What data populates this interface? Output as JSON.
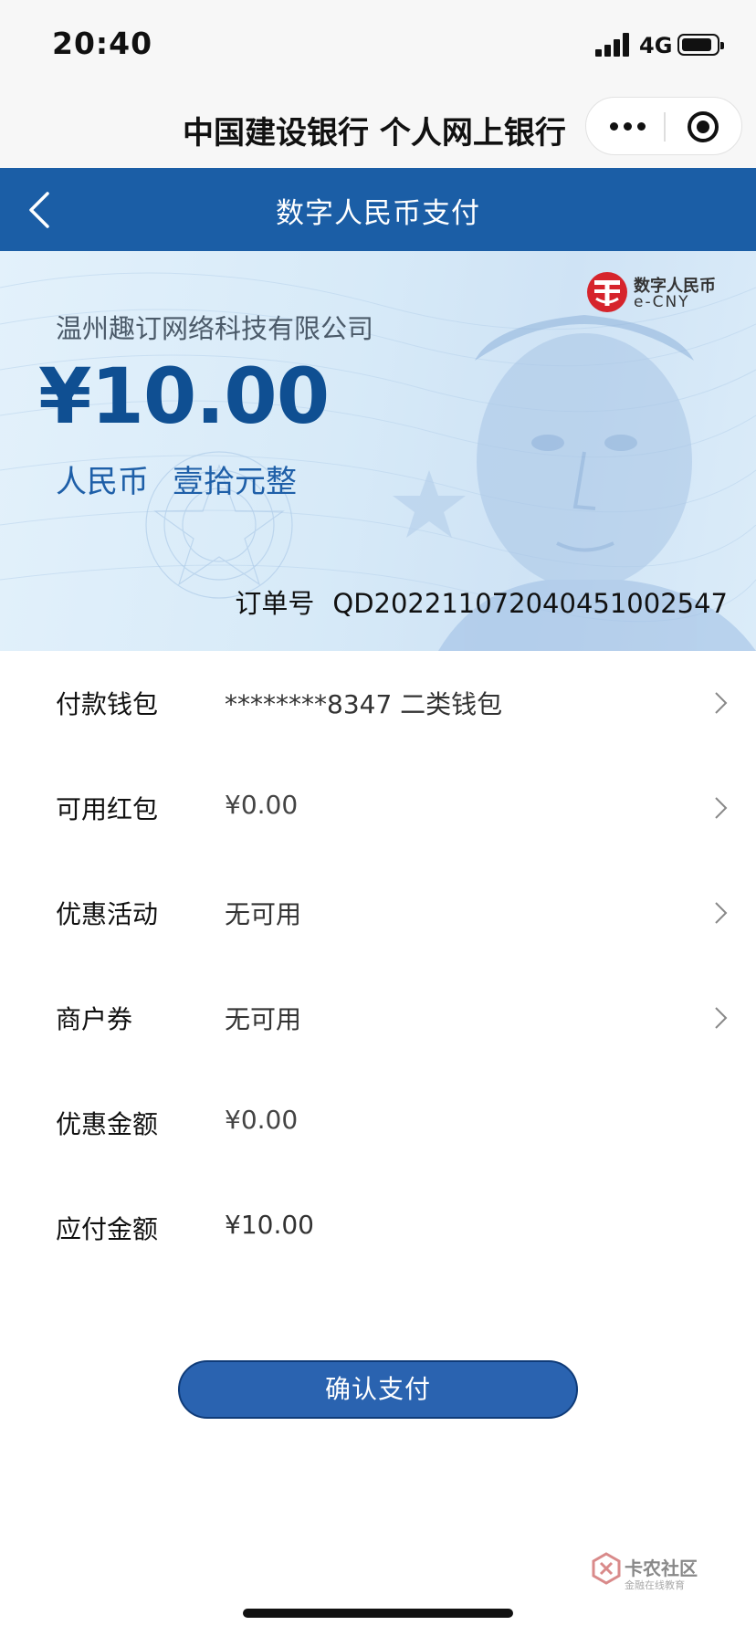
{
  "status_bar": {
    "time": "20:40",
    "network": "4G",
    "signal_icon": "signal-bars-icon",
    "battery_icon": "battery-icon"
  },
  "mini_program": {
    "title": "中国建设银行 个人网上银行",
    "more_icon": "more-dots-icon",
    "close_icon": "target-close-icon"
  },
  "nav": {
    "title": "数字人民币支付",
    "back_icon": "chevron-left-icon",
    "bar_color": "#1b5ea6"
  },
  "payment": {
    "merchant": "温州趣订网络科技有限公司",
    "amount": "¥10.00",
    "currency_label": "人民币",
    "amount_in_words": "壹拾元整",
    "order_label": "订单号",
    "order_number": "QD20221107204045100254​7",
    "brand_cn": "数字人民币",
    "brand_en": "e-CNY"
  },
  "rows": [
    {
      "label": "付款钱包",
      "value": "********8347  二类钱包",
      "has_chevron": true
    },
    {
      "label": "可用红包",
      "value": "¥0.00",
      "has_chevron": true
    },
    {
      "label": "优惠活动",
      "value": "无可用",
      "has_chevron": true
    },
    {
      "label": "商户券",
      "value": "无可用",
      "has_chevron": true
    },
    {
      "label": "优惠金额",
      "value": "¥0.00",
      "has_chevron": false
    },
    {
      "label": "应付金额",
      "value": "¥10.00",
      "has_chevron": false
    }
  ],
  "confirm_button": {
    "label": "确认支付",
    "color": "#2a63b0"
  },
  "watermark": {
    "line1": "卡农社区",
    "line2": "金融在线教育"
  }
}
